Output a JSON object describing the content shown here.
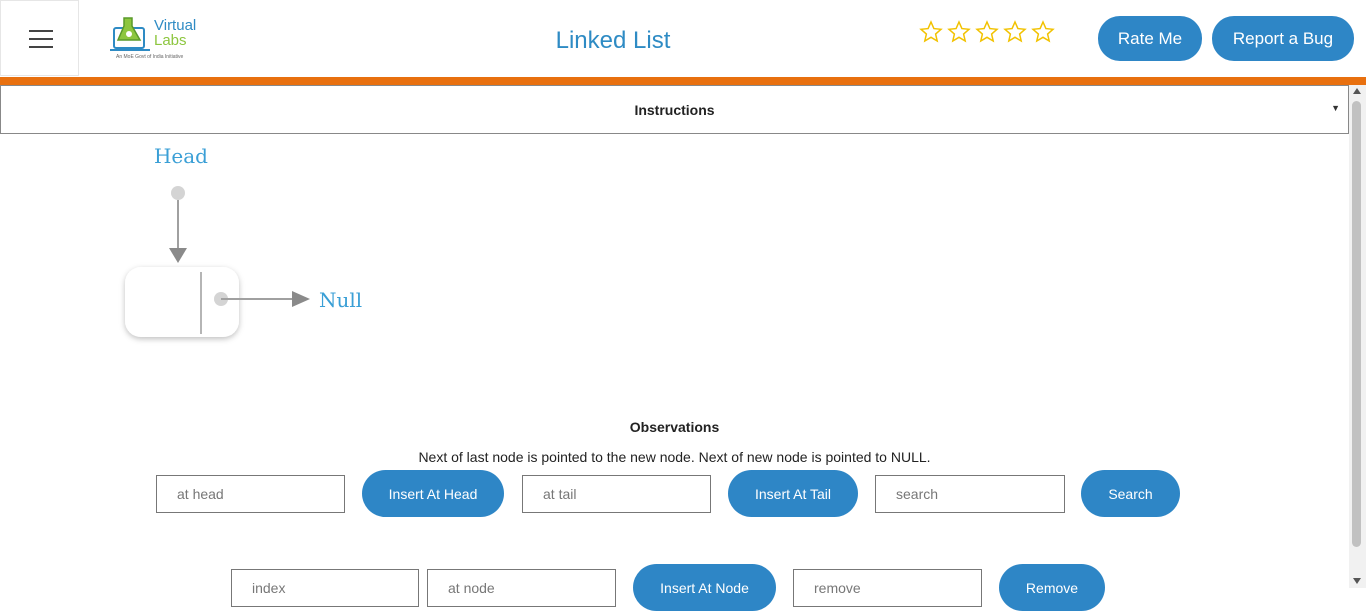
{
  "header": {
    "menu_icon": "hamburger-icon",
    "logo": {
      "line1": "Virtual",
      "line2": "Labs",
      "tagline": "An MoE Govt of India Initiative"
    },
    "title": "Linked List",
    "rating": {
      "max": 5,
      "value": 0,
      "icon": "star-outline-icon"
    },
    "rate_label": "Rate Me",
    "bug_label": "Report a Bug"
  },
  "instructions": {
    "label": "Instructions",
    "caret_icon": "dropdown-caret-icon"
  },
  "diagram": {
    "head_label": "Head",
    "null_label": "Null"
  },
  "observations": {
    "title": "Observations",
    "text": "Next of last node is pointed to the new node. Next of new node is pointed to NULL."
  },
  "controls": {
    "row1": {
      "head_placeholder": "at head",
      "insert_head_label": "Insert At Head",
      "tail_placeholder": "at tail",
      "insert_tail_label": "Insert At Tail",
      "search_placeholder": "search",
      "search_label": "Search"
    },
    "row2": {
      "index_placeholder": "index",
      "node_placeholder": "at node",
      "insert_node_label": "Insert At Node",
      "remove_placeholder": "remove",
      "remove_label": "Remove"
    }
  },
  "colors": {
    "accent": "#2e86c6",
    "orange_bar": "#e8700f",
    "diagram_label": "#3a9fd6",
    "star": "#f2c200"
  }
}
